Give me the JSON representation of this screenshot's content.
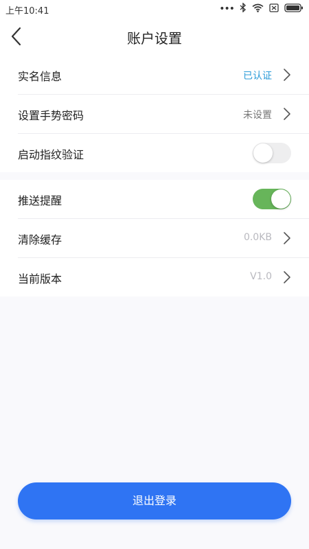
{
  "status_bar": {
    "time": "上午10:41",
    "icons": [
      "more-dots-icon",
      "bluetooth-icon",
      "wifi-icon",
      "sim-blocked-icon",
      "battery-icon"
    ]
  },
  "header": {
    "title": "账户设置",
    "back_icon": "chevron-left-icon"
  },
  "settings": {
    "group1": [
      {
        "label": "实名信息",
        "value": "已认证",
        "type": "link"
      },
      {
        "label": "设置手势密码",
        "value": "未设置",
        "type": "link"
      },
      {
        "label": "启动指纹验证",
        "type": "toggle",
        "enabled": false
      }
    ],
    "group2": [
      {
        "label": "推送提醒",
        "type": "toggle",
        "enabled": true
      },
      {
        "label": "清除缓存",
        "value": "0.0KB",
        "type": "link"
      },
      {
        "label": "当前版本",
        "value": "V1.0",
        "type": "link"
      }
    ]
  },
  "logout": {
    "label": "退出登录"
  },
  "colors": {
    "accent_blue": "#2f74f3",
    "verified_blue": "#2a9bd8",
    "toggle_on": "#67b55a",
    "background": "#f9f9fc"
  }
}
